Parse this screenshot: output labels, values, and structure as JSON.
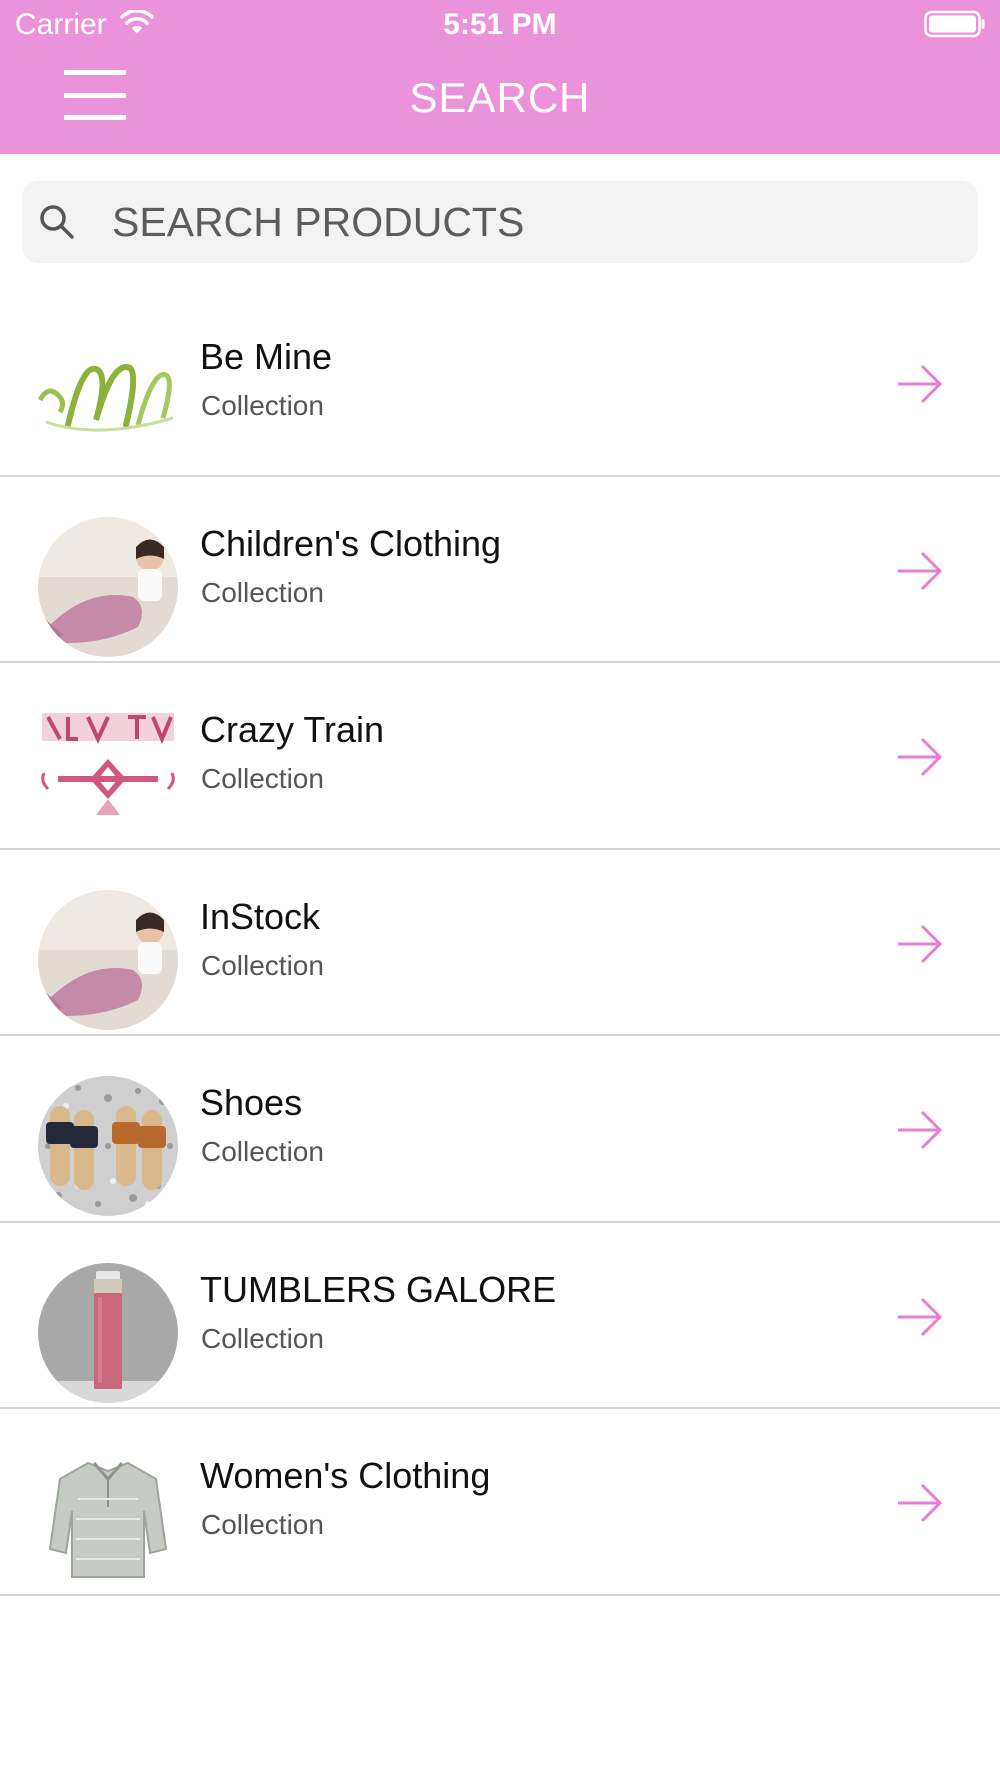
{
  "status_bar": {
    "carrier": "Carrier",
    "time": "5:51 PM"
  },
  "nav": {
    "title": "SEARCH",
    "menu_icon": "hamburger-menu-icon"
  },
  "search": {
    "placeholder": "SEARCH PRODUCTS",
    "icon": "search-icon"
  },
  "colors": {
    "accent": "#ea93da",
    "arrow": "#e87ed4",
    "divider": "#d3d3d3",
    "search_bg": "#f3f3f3"
  },
  "items": [
    {
      "title": "Be Mine",
      "subtitle": "Collection"
    },
    {
      "title": "Children's Clothing",
      "subtitle": "Collection"
    },
    {
      "title": "Crazy Train",
      "subtitle": "Collection"
    },
    {
      "title": "InStock",
      "subtitle": "Collection"
    },
    {
      "title": "Shoes",
      "subtitle": "Collection"
    },
    {
      "title": "TUMBLERS GALORE",
      "subtitle": "Collection"
    },
    {
      "title": "Women's Clothing",
      "subtitle": "Collection"
    }
  ]
}
